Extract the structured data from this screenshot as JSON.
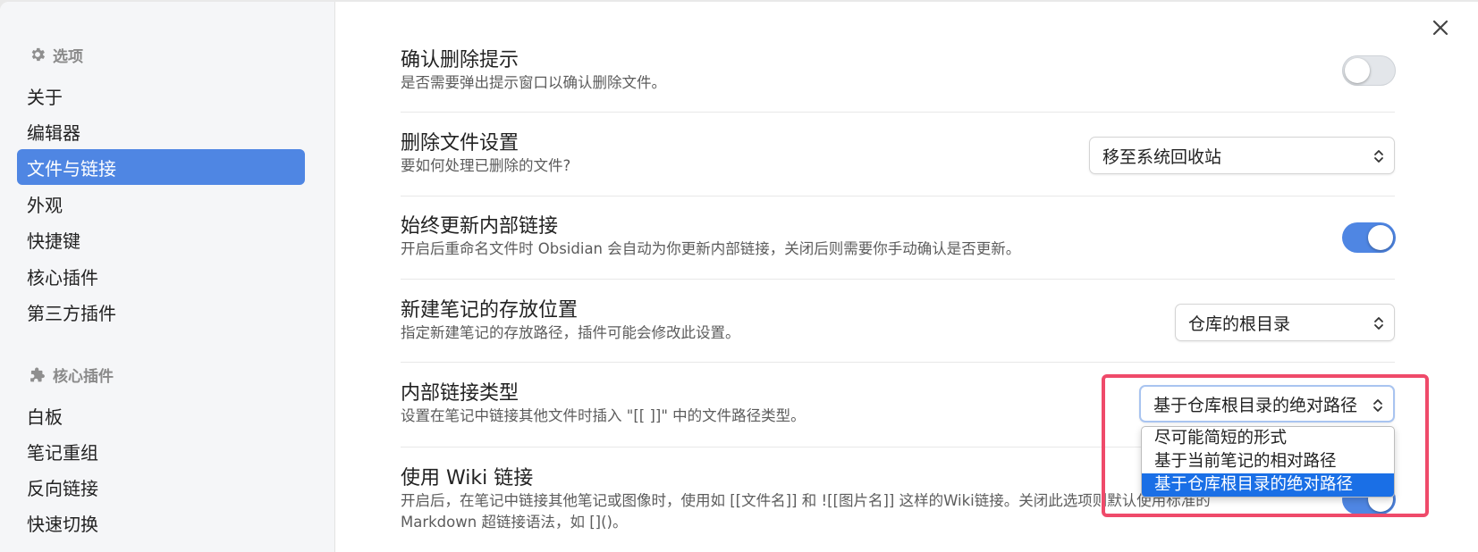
{
  "sidebar": {
    "group1_title": "选项",
    "options": [
      "关于",
      "编辑器",
      "文件与链接",
      "外观",
      "快捷键",
      "核心插件",
      "第三方插件"
    ],
    "active": "文件与链接",
    "group2_title": "核心插件",
    "plugins": [
      "白板",
      "笔记重组",
      "反向链接",
      "快速切换"
    ]
  },
  "settings": [
    {
      "name": "确认删除提示",
      "desc": "是否需要弹出提示窗口以确认删除文件。",
      "control": "toggle",
      "state": "off"
    },
    {
      "name": "删除文件设置",
      "desc": "要如何处理已删除的文件?",
      "control": "select",
      "value": "移至系统回收站"
    },
    {
      "name": "始终更新内部链接",
      "desc": "开启后重命名文件时 Obsidian 会自动为你更新内部链接，关闭后则需要你手动确认是否更新。",
      "control": "toggle",
      "state": "on"
    },
    {
      "name": "新建笔记的存放位置",
      "desc": "指定新建笔记的存放路径，插件可能会修改此设置。",
      "control": "select",
      "value": "仓库的根目录"
    },
    {
      "name": "内部链接类型",
      "desc": "设置在笔记中链接其他文件时插入 \"[[ ]]\" 中的文件路径类型。",
      "control": "select",
      "value": "基于仓库根目录的绝对路径"
    },
    {
      "name": "使用 Wiki 链接",
      "desc": "开启后，在笔记中链接其他笔记或图像时，使用如 [[文件名]] 和 ![[图片名]] 这样的Wiki链接。关闭此选项则默认使用标准的",
      "desc2": "Markdown 超链接语法，如 []()。",
      "control": "toggle",
      "state": "on"
    }
  ],
  "dropdown": {
    "options": [
      "尽可能简短的形式",
      "基于当前笔记的相对路径",
      "基于仓库根目录的绝对路径"
    ],
    "selected": "基于仓库根目录的绝对路径"
  },
  "colors": {
    "accent": "#4f86e3",
    "highlight": "#ef4a6a",
    "selected_option": "#1a6fe6"
  }
}
